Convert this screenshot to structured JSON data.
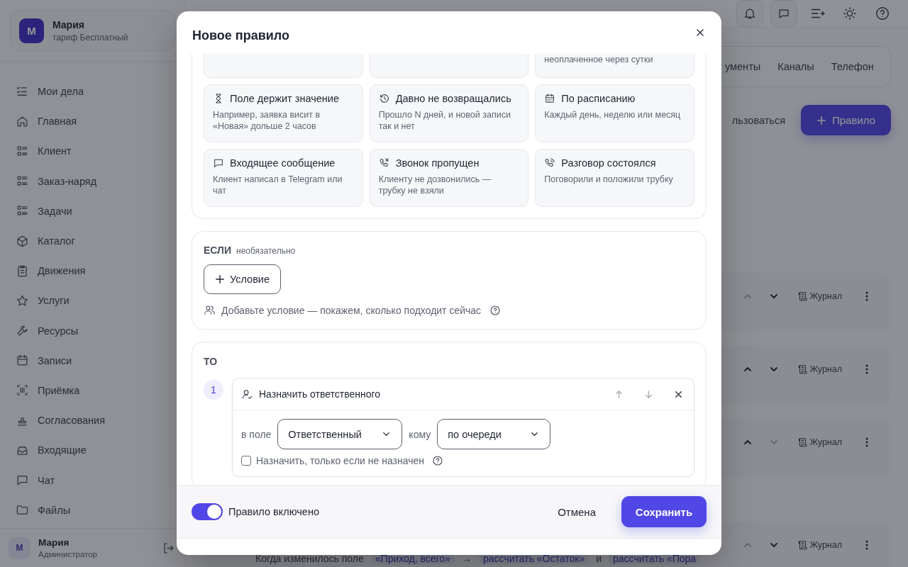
{
  "sidebar": {
    "profile": {
      "avatar": "М",
      "name": "Мария",
      "plan": "тариф Бесплатный"
    },
    "items": [
      {
        "label": "Мои дела"
      },
      {
        "label": "Главная"
      },
      {
        "label": "Клиент"
      },
      {
        "label": "Заказ-наряд"
      },
      {
        "label": "Задачи"
      },
      {
        "label": "Каталог"
      },
      {
        "label": "Движения"
      },
      {
        "label": "Услуги"
      },
      {
        "label": "Ресурсы"
      },
      {
        "label": "Записи"
      },
      {
        "label": "Приёмка"
      },
      {
        "label": "Согласования"
      },
      {
        "label": "Входящие"
      },
      {
        "label": "Чат"
      },
      {
        "label": "Файлы"
      }
    ],
    "user": {
      "avatar": "М",
      "name": "Мария",
      "role": "Администратор"
    }
  },
  "tabs": [
    {
      "label": "ументы"
    },
    {
      "label": "Каналы"
    },
    {
      "label": "Телефон"
    }
  ],
  "toolbar": {
    "link": "льзоваться",
    "add_button": "Правило"
  },
  "rules": [
    {
      "up_disabled": true,
      "down_disabled": false,
      "log": "Журнал"
    },
    {
      "up_disabled": false,
      "down_disabled": false,
      "log": "Журнал"
    },
    {
      "up_disabled": false,
      "down_disabled": true,
      "log": "Журнал"
    },
    {
      "up_disabled": true,
      "down_disabled": false,
      "log": "Журнал",
      "summary": [
        {
          "kind": "text",
          "text": "Когда изменилось поле"
        },
        {
          "kind": "chip",
          "text": "«Приход, всего»"
        },
        {
          "kind": "text",
          "text": "→"
        },
        {
          "kind": "chip",
          "text": "рассчитать «Остаток»"
        },
        {
          "kind": "text",
          "text": "и"
        },
        {
          "kind": "chip",
          "text": "рассчитать «Пора"
        }
      ]
    }
  ],
  "modal": {
    "title": "Новое правило",
    "cut_trigger_desc": "неоплаченное через сутки",
    "triggers": [
      {
        "title": "Поле держит значение",
        "desc": "Например, заявка висит в «Новая» дольше 2 часов"
      },
      {
        "title": "Давно не возвращались",
        "desc": "Прошло N дней, и новой записи так и нет"
      },
      {
        "title": "По расписанию",
        "desc": "Каждый день, неделю или месяц"
      },
      {
        "title": "Входящее сообщение",
        "desc": "Клиент написал в Telegram или чат"
      },
      {
        "title": "Звонок пропущен",
        "desc": "Клиенту не дозвонились — трубку не взяли"
      },
      {
        "title": "Разговор состоялся",
        "desc": "Поговорили и положили трубку"
      }
    ],
    "condition": {
      "label": "ЕСЛИ",
      "hint": "необязательно",
      "add_button": "Условие",
      "info": "Добавьте условие — покажем, сколько подходит сейчас"
    },
    "actions": {
      "label": "ТО",
      "items": [
        {
          "number": "1",
          "title": "Назначить ответственного",
          "field_label": "в поле",
          "field_value": "Ответственный",
          "to_label": "кому",
          "to_value": "по очереди",
          "only_if_unassigned": {
            "label": "Назначить, только если не назначен",
            "checked": false
          }
        }
      ]
    },
    "footer": {
      "toggle": {
        "label": "Правило включено",
        "on": true
      },
      "cancel": "Отмена",
      "save": "Сохранить"
    }
  }
}
